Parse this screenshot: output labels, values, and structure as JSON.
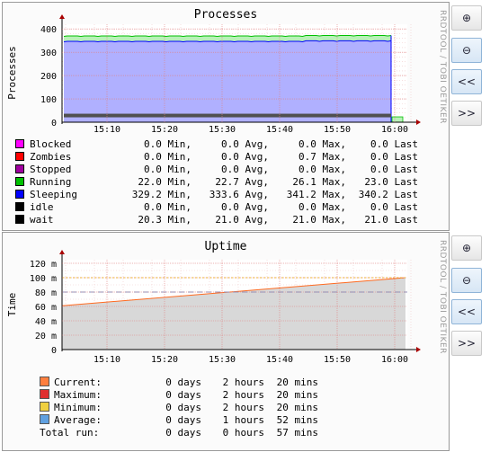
{
  "processes": {
    "title": "Processes",
    "ylabel": "Processes",
    "side_label": "RRDTOOL / TOBI OETIKER",
    "x_ticks": [
      "15:10",
      "15:20",
      "15:30",
      "15:40",
      "15:50",
      "16:00"
    ],
    "y_ticks": [
      "0",
      "100",
      "200",
      "300",
      "400"
    ],
    "legend": [
      {
        "name": "Blocked",
        "color": "#ff00ff",
        "min": "0.0 Min,",
        "avg": "0.0 Avg,",
        "max": "0.0 Max,",
        "last": "0.0 Last"
      },
      {
        "name": "Zombies",
        "color": "#ff0000",
        "min": "0.0 Min,",
        "avg": "0.0 Avg,",
        "max": "0.7 Max,",
        "last": "0.0 Last"
      },
      {
        "name": "Stopped",
        "color": "#a000a0",
        "min": "0.0 Min,",
        "avg": "0.0 Avg,",
        "max": "0.0 Max,",
        "last": "0.0 Last"
      },
      {
        "name": "Running",
        "color": "#00c000",
        "min": "22.0 Min,",
        "avg": "22.7 Avg,",
        "max": "26.1 Max,",
        "last": "23.0 Last"
      },
      {
        "name": "Sleeping",
        "color": "#0000ff",
        "min": "329.2 Min,",
        "avg": "333.6 Avg,",
        "max": "341.2 Max,",
        "last": "340.2 Last"
      },
      {
        "name": "idle",
        "color": "#000000",
        "min": "0.0 Min,",
        "avg": "0.0 Avg,",
        "max": "0.0 Max,",
        "last": "0.0 Last"
      },
      {
        "name": "wait",
        "color": "#000000",
        "min": "20.3 Min,",
        "avg": "21.0 Avg,",
        "max": "21.0 Max,",
        "last": "21.0 Last"
      }
    ]
  },
  "uptime": {
    "title": "Uptime",
    "ylabel": "Time",
    "side_label": "RRDTOOL / TOBI OETIKER",
    "x_ticks": [
      "15:10",
      "15:20",
      "15:30",
      "15:40",
      "15:50",
      "16:00"
    ],
    "y_ticks": [
      "0",
      "20 m",
      "40 m",
      "60 m",
      "80 m",
      "100 m",
      "120 m"
    ],
    "legend": [
      {
        "name": "Current:",
        "color": "#ff7f3f",
        "days": "0 days",
        "hours": "2 hours",
        "mins": "20 mins"
      },
      {
        "name": "Maximum:",
        "color": "#e03030",
        "days": "0 days",
        "hours": "2 hours",
        "mins": "20 mins"
      },
      {
        "name": "Minimum:",
        "color": "#f0d040",
        "days": "0 days",
        "hours": "2 hours",
        "mins": "20 mins"
      },
      {
        "name": "Average:",
        "color": "#60a0e0",
        "days": "0 days",
        "hours": "1 hours",
        "mins": "52 mins"
      }
    ],
    "total_label": "Total run:",
    "total": {
      "days": "0 days",
      "hours": "0 hours",
      "mins": "57 mins"
    }
  },
  "controls": {
    "zoom_in": "⊕",
    "zoom_out": "⊖",
    "back": "<<",
    "forward": ">>"
  },
  "chart_data": [
    {
      "type": "area",
      "title": "Processes",
      "ylabel": "Processes",
      "x": [
        "15:10",
        "15:20",
        "15:30",
        "15:40",
        "15:50",
        "16:00"
      ],
      "ylim": [
        0,
        420
      ],
      "series": [
        {
          "name": "Sleeping",
          "values": [
            347,
            347,
            347,
            347,
            347,
            350
          ]
        },
        {
          "name": "Running",
          "values": [
            23,
            23,
            23,
            23,
            23,
            23
          ]
        },
        {
          "name": "wait",
          "values": [
            21,
            21,
            21,
            21,
            21,
            21
          ]
        }
      ]
    },
    {
      "type": "area",
      "title": "Uptime",
      "ylabel": "Time",
      "x": [
        "15:10",
        "15:20",
        "15:30",
        "15:40",
        "15:50",
        "16:00"
      ],
      "ylim": [
        0,
        125
      ],
      "series": [
        {
          "name": "Current:",
          "values": [
            64,
            72,
            80,
            88,
            96,
            100
          ]
        }
      ]
    }
  ]
}
